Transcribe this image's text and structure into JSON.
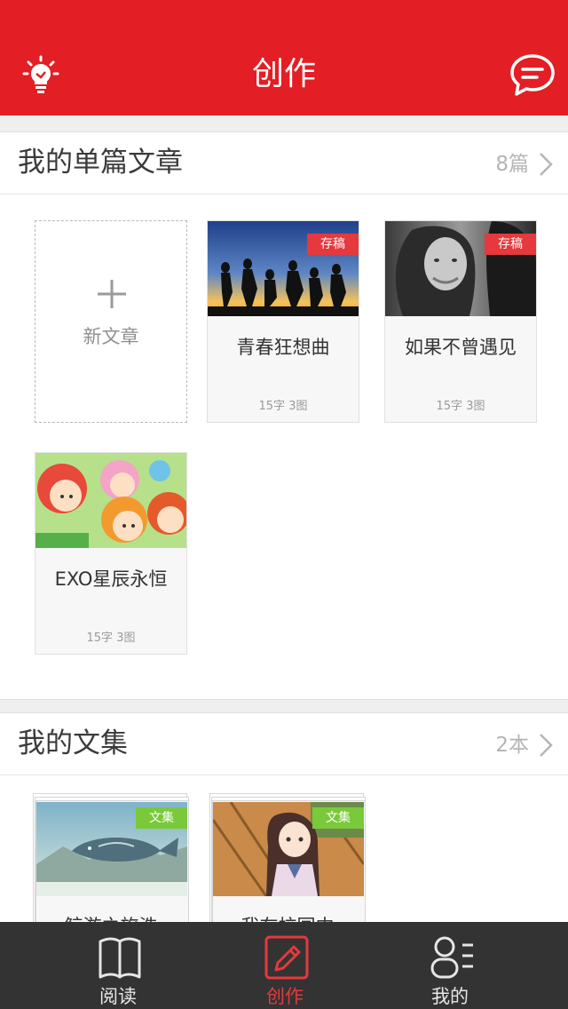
{
  "header": {
    "title": "创作",
    "left_icon": "lightbulb-icon",
    "right_icon": "message-bubble-icon"
  },
  "articles": {
    "title": "我的单篇文章",
    "count": "8篇",
    "new_label": "新文章",
    "items": [
      {
        "name": "青春狂想曲",
        "meta": "15字 3图",
        "badge": "存稿"
      },
      {
        "name": "如果不曾遇见",
        "meta": "15字 3图",
        "badge": "存稿"
      },
      {
        "name": "EXO星辰永恒",
        "meta": "15字 3图"
      }
    ]
  },
  "collections": {
    "title": "我的文集",
    "count": "2本",
    "items": [
      {
        "name": "鲸游之旅浩",
        "badge": "文集"
      },
      {
        "name": "我在校园中",
        "badge": "文集"
      }
    ]
  },
  "tabbar": {
    "items": [
      {
        "label": "阅读",
        "icon": "book-icon"
      },
      {
        "label": "创作",
        "icon": "pencil-edit-icon",
        "active": true
      },
      {
        "label": "我的",
        "icon": "profile-list-icon"
      }
    ]
  },
  "colors": {
    "brand_red": "#e31e24",
    "badge_red": "#e5393d",
    "badge_green": "#7ac93a",
    "tabbar_bg": "#333333"
  }
}
